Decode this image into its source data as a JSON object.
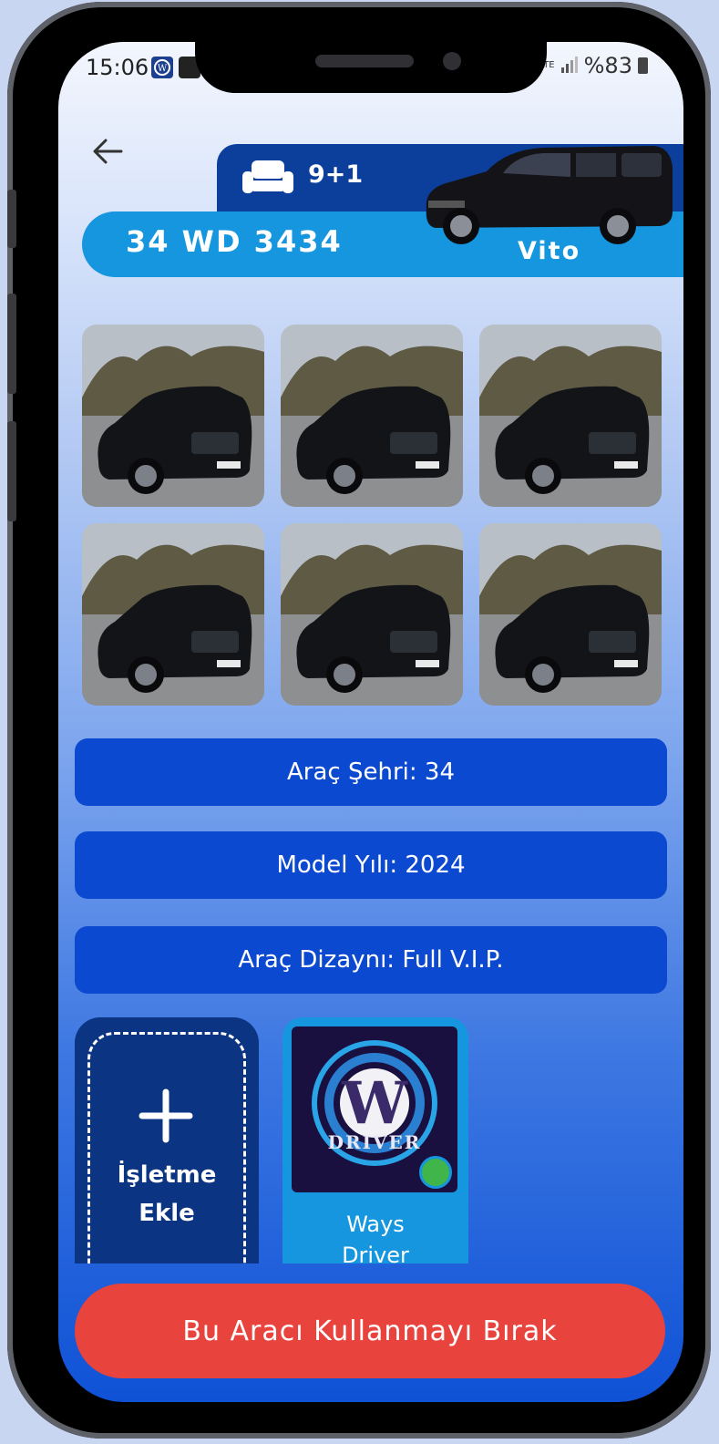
{
  "status_bar": {
    "time": "15:06",
    "right_text": "%83",
    "lte": "LTE"
  },
  "header": {
    "seat_count": "9+1",
    "plate": "34 WD 3434",
    "model": "Vito"
  },
  "photos": [
    "vehicle-photo",
    "vehicle-photo",
    "vehicle-photo",
    "vehicle-photo",
    "vehicle-photo",
    "vehicle-photo"
  ],
  "info": {
    "city": "Araç Şehri: 34",
    "year": "Model Yılı: 2024",
    "design": "Araç Dizaynı: Full V.I.P."
  },
  "business": {
    "add_line1": "İşletme",
    "add_line2": "Ekle",
    "name_line1": "Ways",
    "name_line2": "Driver",
    "logo_text": "DRIVER",
    "logo_letter": "W"
  },
  "actions": {
    "leave": "Bu Aracı Kullanmayı Bırak"
  },
  "colors": {
    "accent": "#1596de",
    "dark_blue": "#0b3f9b",
    "info_blue": "#0b4ad0",
    "danger": "#e8433d",
    "online": "#3fb54a"
  }
}
